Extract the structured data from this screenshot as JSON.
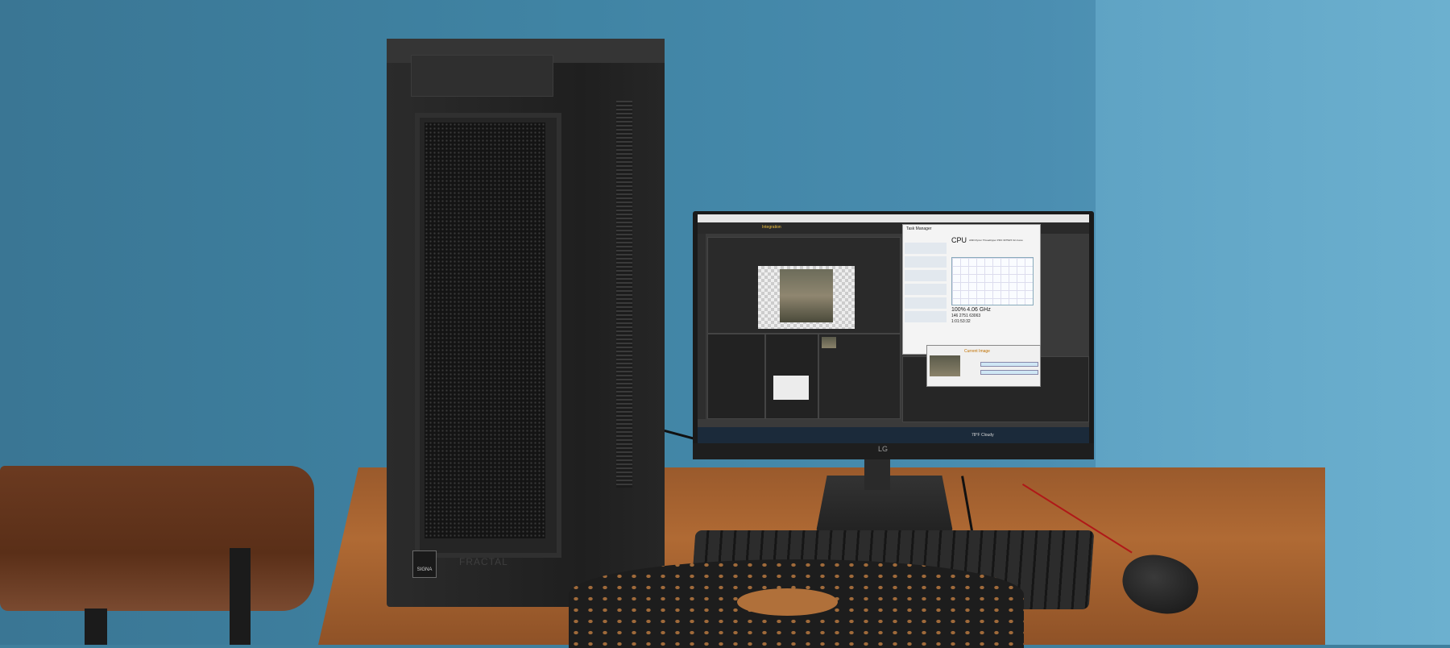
{
  "scene": {
    "tower": {
      "badge_text": "SIGNA",
      "brand_text": "FRACTAL"
    },
    "monitor": {
      "brand_text": "LG",
      "app": {
        "title": "Integration"
      },
      "task_manager": {
        "title": "Task Manager",
        "section": "CPU",
        "cpu_name": "AMD Ryzen Threadripper PRO 3975WX 32-Cores",
        "utilization": "100%",
        "speed": "4.06 GHz",
        "processes": "146",
        "threads": "2751",
        "handles": "63063",
        "uptime": "1:01:53:32"
      },
      "render": {
        "title": "Current Image"
      },
      "taskbar": {
        "weather": "78°F Cloudy"
      }
    }
  },
  "colors": {
    "wall": "#4084a4",
    "desk": "#b06a34",
    "tower": "#1f1f1f"
  }
}
